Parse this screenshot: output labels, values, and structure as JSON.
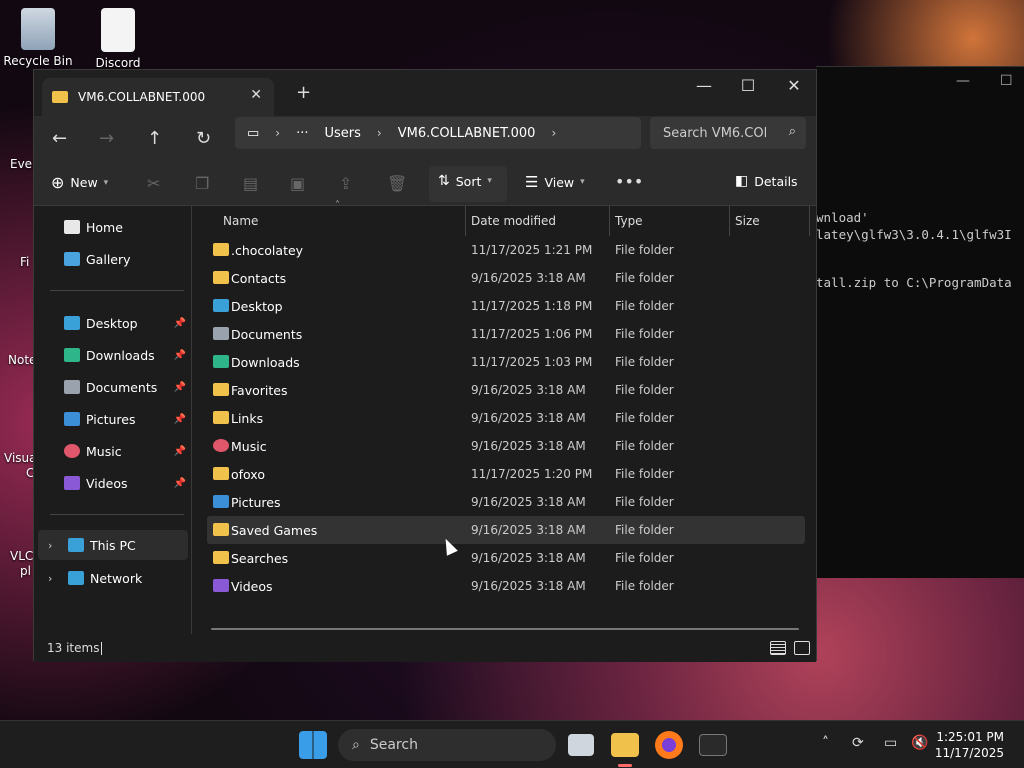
{
  "desktop": {
    "icons": [
      {
        "label": "Recycle Bin"
      },
      {
        "label": "Discord"
      }
    ],
    "fragments": [
      "Ever",
      "Fi",
      "Note",
      "Visua",
      "C",
      "VLC",
      "pl"
    ]
  },
  "terminal": {
    "lines": [
      "wnload'",
      "latey\\glfw3\\3.0.4.1\\glfw3I",
      "",
      "tall.zip to C:\\ProgramData"
    ]
  },
  "explorer": {
    "tab_title": "VM6.COLLABNET.000",
    "breadcrumb": [
      "Users",
      "VM6.COLLABNET.000"
    ],
    "search_placeholder": "Search VM6.COl",
    "toolbar": {
      "new_label": "New",
      "sort_label": "Sort",
      "view_label": "View",
      "details_label": "Details"
    },
    "nav": {
      "top": [
        {
          "label": "Home",
          "icon": "home-icon",
          "color": "#e8e8e8"
        },
        {
          "label": "Gallery",
          "icon": "gallery-icon",
          "color": "#4aa3df"
        }
      ],
      "quick": [
        {
          "label": "Desktop",
          "icon": "desktop-folder-icon",
          "color": "#3aa0d8"
        },
        {
          "label": "Downloads",
          "icon": "downloads-icon",
          "color": "#2fb58a"
        },
        {
          "label": "Documents",
          "icon": "documents-icon",
          "color": "#9aa3ad"
        },
        {
          "label": "Pictures",
          "icon": "pictures-icon",
          "color": "#3b8fd6"
        },
        {
          "label": "Music",
          "icon": "music-icon",
          "color": "#e0566a"
        },
        {
          "label": "Videos",
          "icon": "videos-icon",
          "color": "#8a5ad6"
        }
      ],
      "bottom": [
        {
          "label": "This PC",
          "icon": "this-pc-icon",
          "color": "#3aa0d8"
        },
        {
          "label": "Network",
          "icon": "network-icon",
          "color": "#3aa0d8"
        }
      ]
    },
    "columns": {
      "name": "Name",
      "date": "Date modified",
      "type": "Type",
      "size": "Size"
    },
    "rows": [
      {
        "name": ".chocolatey",
        "date": "11/17/2025 1:21 PM",
        "type": "File folder",
        "icon": "folder-icon",
        "color": "#f0c24b"
      },
      {
        "name": "Contacts",
        "date": "9/16/2025 3:18 AM",
        "type": "File folder",
        "icon": "folder-icon",
        "color": "#f0c24b"
      },
      {
        "name": "Desktop",
        "date": "11/17/2025 1:18 PM",
        "type": "File folder",
        "icon": "desktop-folder-icon",
        "color": "#3aa0d8"
      },
      {
        "name": "Documents",
        "date": "11/17/2025 1:06 PM",
        "type": "File folder",
        "icon": "documents-icon",
        "color": "#9aa3ad"
      },
      {
        "name": "Downloads",
        "date": "11/17/2025 1:03 PM",
        "type": "File folder",
        "icon": "downloads-icon",
        "color": "#2fb58a"
      },
      {
        "name": "Favorites",
        "date": "9/16/2025 3:18 AM",
        "type": "File folder",
        "icon": "folder-icon",
        "color": "#f0c24b"
      },
      {
        "name": "Links",
        "date": "9/16/2025 3:18 AM",
        "type": "File folder",
        "icon": "folder-icon",
        "color": "#f0c24b"
      },
      {
        "name": "Music",
        "date": "9/16/2025 3:18 AM",
        "type": "File folder",
        "icon": "music-icon",
        "color": "#e0566a"
      },
      {
        "name": "ofoxo",
        "date": "11/17/2025 1:20 PM",
        "type": "File folder",
        "icon": "folder-icon",
        "color": "#f0c24b"
      },
      {
        "name": "Pictures",
        "date": "9/16/2025 3:18 AM",
        "type": "File folder",
        "icon": "pictures-icon",
        "color": "#3b8fd6"
      },
      {
        "name": "Saved Games",
        "date": "9/16/2025 3:18 AM",
        "type": "File folder",
        "icon": "folder-icon",
        "color": "#f0c24b"
      },
      {
        "name": "Searches",
        "date": "9/16/2025 3:18 AM",
        "type": "File folder",
        "icon": "folder-icon",
        "color": "#f0c24b"
      },
      {
        "name": "Videos",
        "date": "9/16/2025 3:18 AM",
        "type": "File folder",
        "icon": "videos-icon",
        "color": "#8a5ad6"
      }
    ],
    "hover_row": "Saved Games",
    "status": "13 items"
  },
  "taskbar": {
    "search_label": "Search",
    "time": "1:25:01 PM",
    "date": "11/17/2025"
  }
}
